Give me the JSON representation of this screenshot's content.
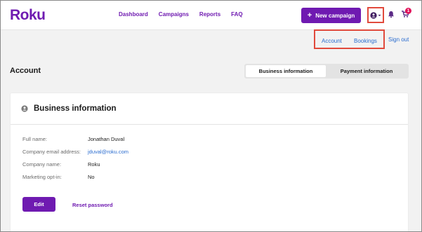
{
  "brand": {
    "logo_text": "Roku",
    "accent": "#6f1ab1",
    "link": "#2a6ccf",
    "highlight": "#e14a3c"
  },
  "nav": {
    "items": [
      {
        "label": "Dashboard"
      },
      {
        "label": "Campaigns"
      },
      {
        "label": "Reports"
      },
      {
        "label": "FAQ"
      }
    ]
  },
  "header": {
    "new_campaign_label": "New campaign",
    "new_campaign_icon": "plus-icon",
    "user_menu_icon": "user-circle-icon",
    "notifications_icon": "bell-icon",
    "cart_icon": "cart-icon",
    "cart_count": "1"
  },
  "account_menu": {
    "account": "Account",
    "bookings": "Bookings",
    "sign_out": "Sign out"
  },
  "page": {
    "title": "Account",
    "tabs": [
      {
        "label": "Business information",
        "active": true
      },
      {
        "label": "Payment information",
        "active": false
      }
    ]
  },
  "card": {
    "icon": "user-circle-icon",
    "title": "Business information",
    "fields": [
      {
        "label": "Full name:",
        "value": "Jonathan Duval"
      },
      {
        "label": "Company email address:",
        "value": "jduval@roku.com"
      },
      {
        "label": "Company name:",
        "value": "Roku"
      },
      {
        "label": "Marketing opt-in:",
        "value": "No"
      }
    ],
    "edit_label": "Edit",
    "reset_label": "Reset password"
  }
}
